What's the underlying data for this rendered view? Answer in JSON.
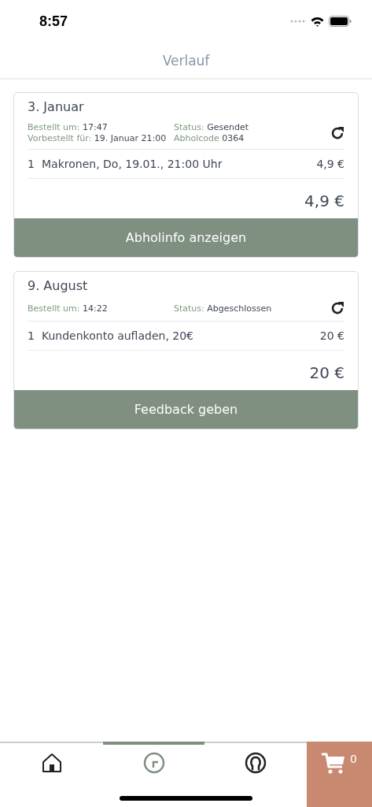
{
  "status_bar": {
    "time": "8:57"
  },
  "header": {
    "title": "Verlauf"
  },
  "orders": [
    {
      "date": "3. Januar",
      "meta": [
        {
          "label": "Bestellt um:",
          "value": "17:47"
        },
        {
          "label": "Status:",
          "value": "Gesendet"
        },
        {
          "label": "Vorbestellt für:",
          "value": "19. Januar 21:00"
        },
        {
          "label": "Abholcode",
          "value": "0364"
        }
      ],
      "items": [
        {
          "qty": "1",
          "name": "Makronen, Do, 19.01., 21:00 Uhr",
          "price": "4,9 €"
        }
      ],
      "total": "4,9 €",
      "action": "Abholinfo anzeigen"
    },
    {
      "date": "9. August",
      "meta": [
        {
          "label": "Bestellt um:",
          "value": "14:22"
        },
        {
          "label": "Status:",
          "value": "Abgeschlossen"
        }
      ],
      "items": [
        {
          "qty": "1",
          "name": "Kundenkonto aufladen, 20€",
          "price": "20 €"
        }
      ],
      "total": "20 €",
      "action": "Feedback geben"
    }
  ],
  "tab_bar": {
    "tabs": [
      {
        "kind": "home",
        "selected": false
      },
      {
        "kind": "history",
        "selected": true
      },
      {
        "kind": "account",
        "selected": false
      }
    ],
    "cart": {
      "count": "0"
    }
  }
}
